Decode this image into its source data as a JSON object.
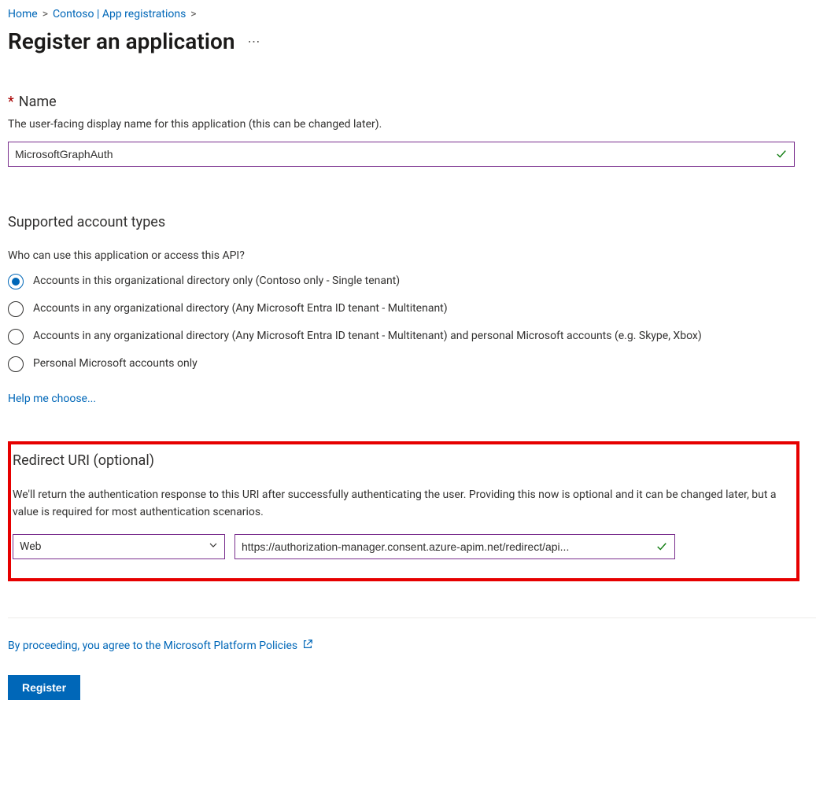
{
  "breadcrumb": {
    "home": "Home",
    "mid": "Contoso | App registrations"
  },
  "page_title": "Register an application",
  "name_section": {
    "label": "Name",
    "desc": "The user-facing display name for this application (this can be changed later).",
    "value": "MicrosoftGraphAuth"
  },
  "account_types": {
    "heading": "Supported account types",
    "question": "Who can use this application or access this API?",
    "options": [
      "Accounts in this organizational directory only (Contoso only - Single tenant)",
      "Accounts in any organizational directory (Any Microsoft Entra ID tenant - Multitenant)",
      "Accounts in any organizational directory (Any Microsoft Entra ID tenant - Multitenant) and personal Microsoft accounts (e.g. Skype, Xbox)",
      "Personal Microsoft accounts only"
    ],
    "selected_index": 0,
    "help_link": "Help me choose..."
  },
  "redirect": {
    "heading": "Redirect URI (optional)",
    "desc": "We'll return the authentication response to this URI after successfully authenticating the user. Providing this now is optional and it can be changed later, but a value is required for most authentication scenarios.",
    "platform_selected": "Web",
    "uri_value": "https://authorization-manager.consent.azure-apim.net/redirect/api..."
  },
  "footer": {
    "policies_text": "By proceeding, you agree to the Microsoft Platform Policies",
    "register_label": "Register"
  }
}
